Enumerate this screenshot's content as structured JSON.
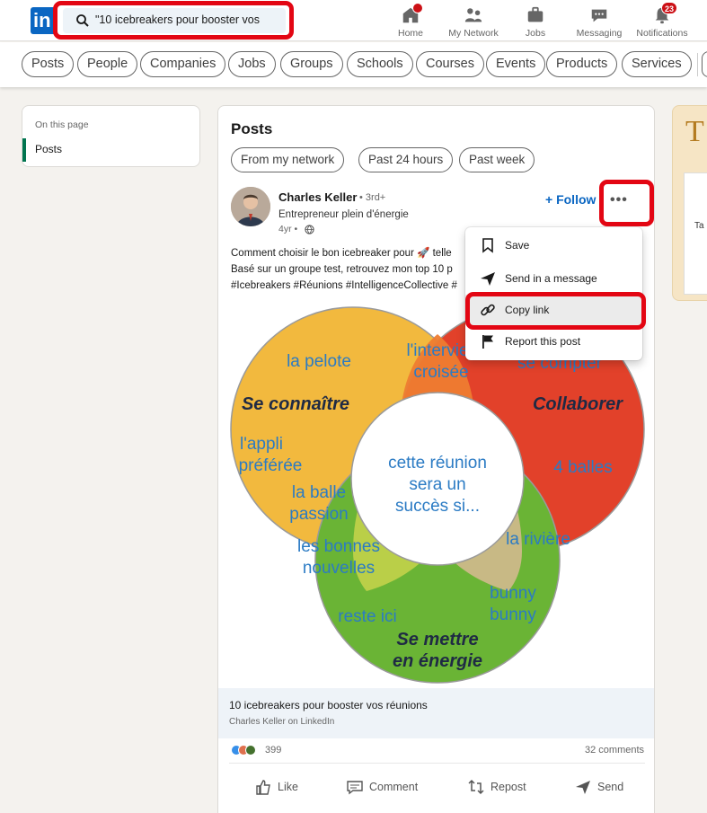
{
  "nav": {
    "logo": "in",
    "search_value": "\"10 icebreakers pour booster vos",
    "items": [
      {
        "label": "Home",
        "icon": "home-icon"
      },
      {
        "label": "My Network",
        "icon": "network-icon"
      },
      {
        "label": "Jobs",
        "icon": "briefcase-icon"
      },
      {
        "label": "Messaging",
        "icon": "messaging-icon"
      },
      {
        "label": "Notifications",
        "icon": "bell-icon",
        "badge": "23"
      }
    ]
  },
  "filters": [
    "Posts",
    "People",
    "Companies",
    "Jobs",
    "Groups",
    "Schools",
    "Courses",
    "Events",
    "Products",
    "Services"
  ],
  "left": {
    "heading": "On this page",
    "item": "Posts"
  },
  "main": {
    "title": "Posts",
    "subfilters": [
      "From my network",
      "Past 24 hours",
      "Past week"
    ],
    "post": {
      "author": "Charles Keller",
      "degree": "• 3rd+",
      "tagline": "Entrepreneur plein d'énergie",
      "age": "4yr •",
      "follow": "Follow",
      "more": "•••",
      "text_lines": [
        "Comment choisir le bon icebreaker pour 🚀 telle",
        "Basé sur un groupe test, retrouvez mon top 10 p",
        "#Icebreakers #Réunions #IntelligenceCollective #"
      ],
      "venn": {
        "center": [
          "cette réunion",
          "sera un",
          "succès si..."
        ],
        "labels": {
          "se_connaitre": "Se connaître",
          "collaborer": "Collaborer",
          "energie": [
            "Se mettre",
            "en énergie"
          ],
          "pelote": "la pelote",
          "appli": [
            "l'appli",
            "préférée"
          ],
          "interview": [
            "l'intervie",
            "croisée"
          ],
          "compter": "se compter",
          "balles": "4 balles",
          "balle_passion": [
            "la balle",
            "passion"
          ],
          "bonnes": [
            "les bonnes",
            "nouvelles"
          ],
          "riviere": "la rivière",
          "reste": "reste ici",
          "bunny": [
            "bunny",
            "bunny"
          ]
        }
      },
      "link_title": "10 icebreakers pour booster vos réunions",
      "link_source": "Charles Keller on LinkedIn",
      "reactions": "399",
      "comments": "32 comments",
      "actions": [
        "Like",
        "Comment",
        "Repost",
        "Send"
      ]
    }
  },
  "menu": {
    "items": [
      {
        "label": "Save",
        "icon": "bookmark-icon"
      },
      {
        "label": "Send in a message",
        "icon": "send-icon"
      },
      {
        "label": "Copy link",
        "icon": "link-icon"
      },
      {
        "label": "Report this post",
        "icon": "flag-icon"
      }
    ]
  },
  "right": {
    "initial": "T",
    "snippet": "Ta"
  },
  "colors": {
    "linkedin_blue": "#0a66c2",
    "highlight_red": "#e30613",
    "venn_yellow": "#f2b93e",
    "venn_red": "#e2412a",
    "venn_green": "#6ab435",
    "venn_text_blue": "#2b7bc4"
  }
}
